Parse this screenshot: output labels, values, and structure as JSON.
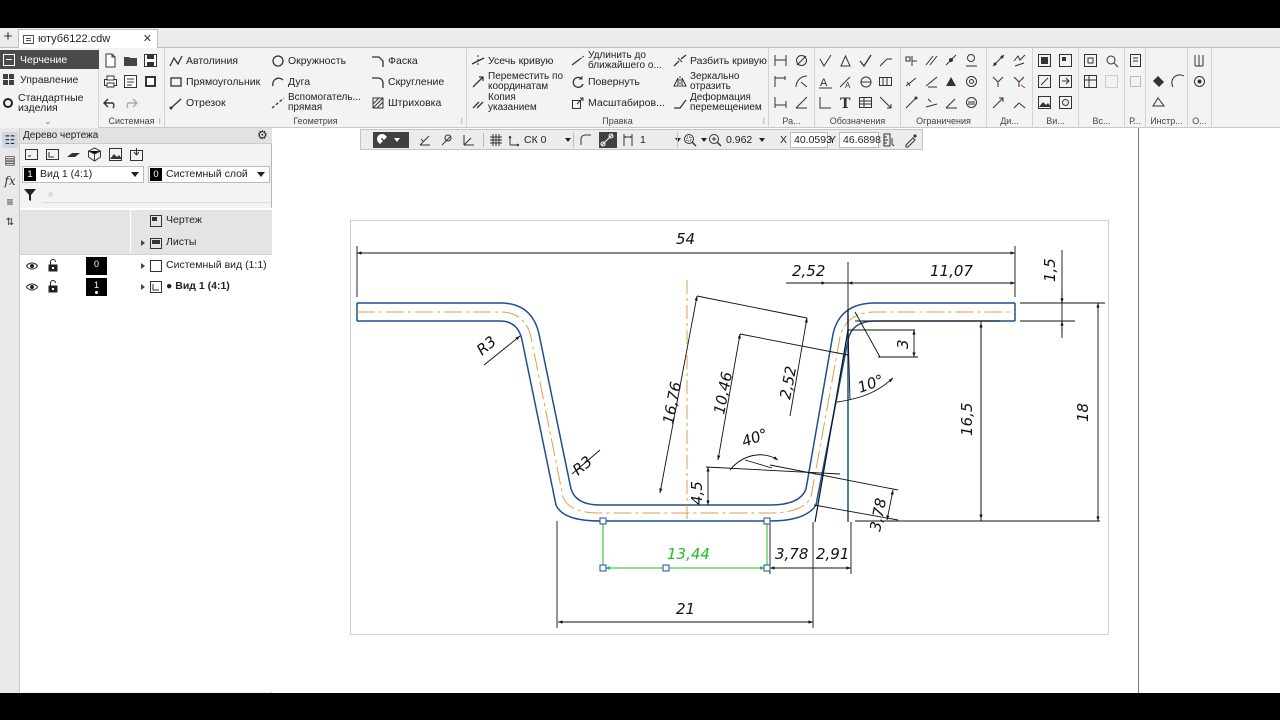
{
  "document": {
    "tab_title": "ютуб6122.cdw",
    "new_tab_symbol": "+",
    "close_symbol": "✕"
  },
  "modes": [
    {
      "label": "Черчение",
      "active": true,
      "icon": "drawing-icon"
    },
    {
      "label": "Управление",
      "active": false,
      "icon": "grid-icon"
    },
    {
      "label": "Стандартные изделия",
      "active": false,
      "icon": "gear-icon"
    }
  ],
  "ribbon": {
    "groups": [
      {
        "id": "system",
        "label": "Системная"
      },
      {
        "id": "geometry",
        "label": "Геометрия"
      },
      {
        "id": "edit",
        "label": "Правка"
      },
      {
        "id": "ra",
        "label": "Ра..."
      },
      {
        "id": "notation",
        "label": "Обозначения"
      },
      {
        "id": "constraints",
        "label": "Ограничения"
      },
      {
        "id": "di",
        "label": "Ди..."
      },
      {
        "id": "vi",
        "label": "Ви..."
      },
      {
        "id": "vs",
        "label": "Вс..."
      },
      {
        "id": "r",
        "label": "Р..."
      },
      {
        "id": "instr",
        "label": "Инстр..."
      },
      {
        "id": "o",
        "label": "О..."
      }
    ],
    "geometry_cmds": [
      {
        "label": "Автолиния",
        "icon": "autoline-icon"
      },
      {
        "label": "Прямоугольник",
        "icon": "rectangle-icon"
      },
      {
        "label": "Отрезок",
        "icon": "segment-icon"
      },
      {
        "label": "Окружность",
        "icon": "circle-icon"
      },
      {
        "label": "Дуга",
        "icon": "arc-icon"
      },
      {
        "label": "Вспомогатель...",
        "label2": "прямая",
        "icon": "aux-line-icon"
      },
      {
        "label": "Фаска",
        "icon": "chamfer-icon"
      },
      {
        "label": "Скругление",
        "icon": "fillet-icon"
      },
      {
        "label": "Штриховка",
        "icon": "hatch-icon"
      }
    ],
    "edit_cmds": [
      {
        "label": "Усечь кривую",
        "icon": "trim-curve-icon"
      },
      {
        "label": "Переместить по",
        "label2": "координатам",
        "icon": "move-coords-icon"
      },
      {
        "label": "Копия",
        "label2": "указанием",
        "icon": "copy-icon"
      },
      {
        "label": "Удлинить до",
        "label2": "ближайшего о...",
        "icon": "extend-icon"
      },
      {
        "label": "Повернуть",
        "icon": "rotate-icon"
      },
      {
        "label": "Масштабиров...",
        "icon": "scale-icon"
      },
      {
        "label": "Разбить кривую",
        "icon": "split-curve-icon"
      },
      {
        "label": "Зеркально",
        "label2": "отразить",
        "icon": "mirror-icon"
      },
      {
        "label": "Деформация",
        "label2": "перемещением",
        "icon": "deform-icon"
      }
    ]
  },
  "tree": {
    "title": "Дерево чертежа",
    "view_combo": {
      "num": "1",
      "label": "Вид 1 (4:1)"
    },
    "layer_combo": {
      "num": "0",
      "label": "Системный слой"
    },
    "search_placeholder": "⌕",
    "nodes": [
      {
        "label": "Чертеж",
        "icon": "drawing-node-icon"
      },
      {
        "label": "Листы",
        "icon": "sheets-icon"
      },
      {
        "label": "Системный вид (1:1)",
        "badge": "0",
        "icon": "system-view-icon"
      },
      {
        "label": "● Вид 1 (4:1)",
        "badge": "1",
        "icon": "view-icon"
      }
    ]
  },
  "canvas_toolbar": {
    "cs": "СК 0",
    "step": "1",
    "zoom": "0.962",
    "x_label": "X",
    "x_value": "40.0593",
    "y_label": "Y",
    "y_value": "46.6898"
  },
  "dimensions": {
    "d54": "54",
    "d252a": "2,52",
    "d1107": "11,07",
    "d15": "1,5",
    "r3a": "R3",
    "r3b": "R3",
    "d3": "3",
    "d1676": "16,76",
    "d1046": "10,46",
    "d252b": "2,52",
    "d10deg": "10°",
    "d165": "16,5",
    "d18": "18",
    "d40deg": "40°",
    "d45": "4,5",
    "d378a": "3,78",
    "d1344": "13,44",
    "d378b": "3,78",
    "d291": "2,91",
    "d21": "21"
  },
  "colors": {
    "contour": "#1f4f8f",
    "centerline": "#e0a040",
    "dimension": "#111111",
    "active_dim": "#1fbf1f",
    "mode_active_bg": "#4a4a4a"
  }
}
